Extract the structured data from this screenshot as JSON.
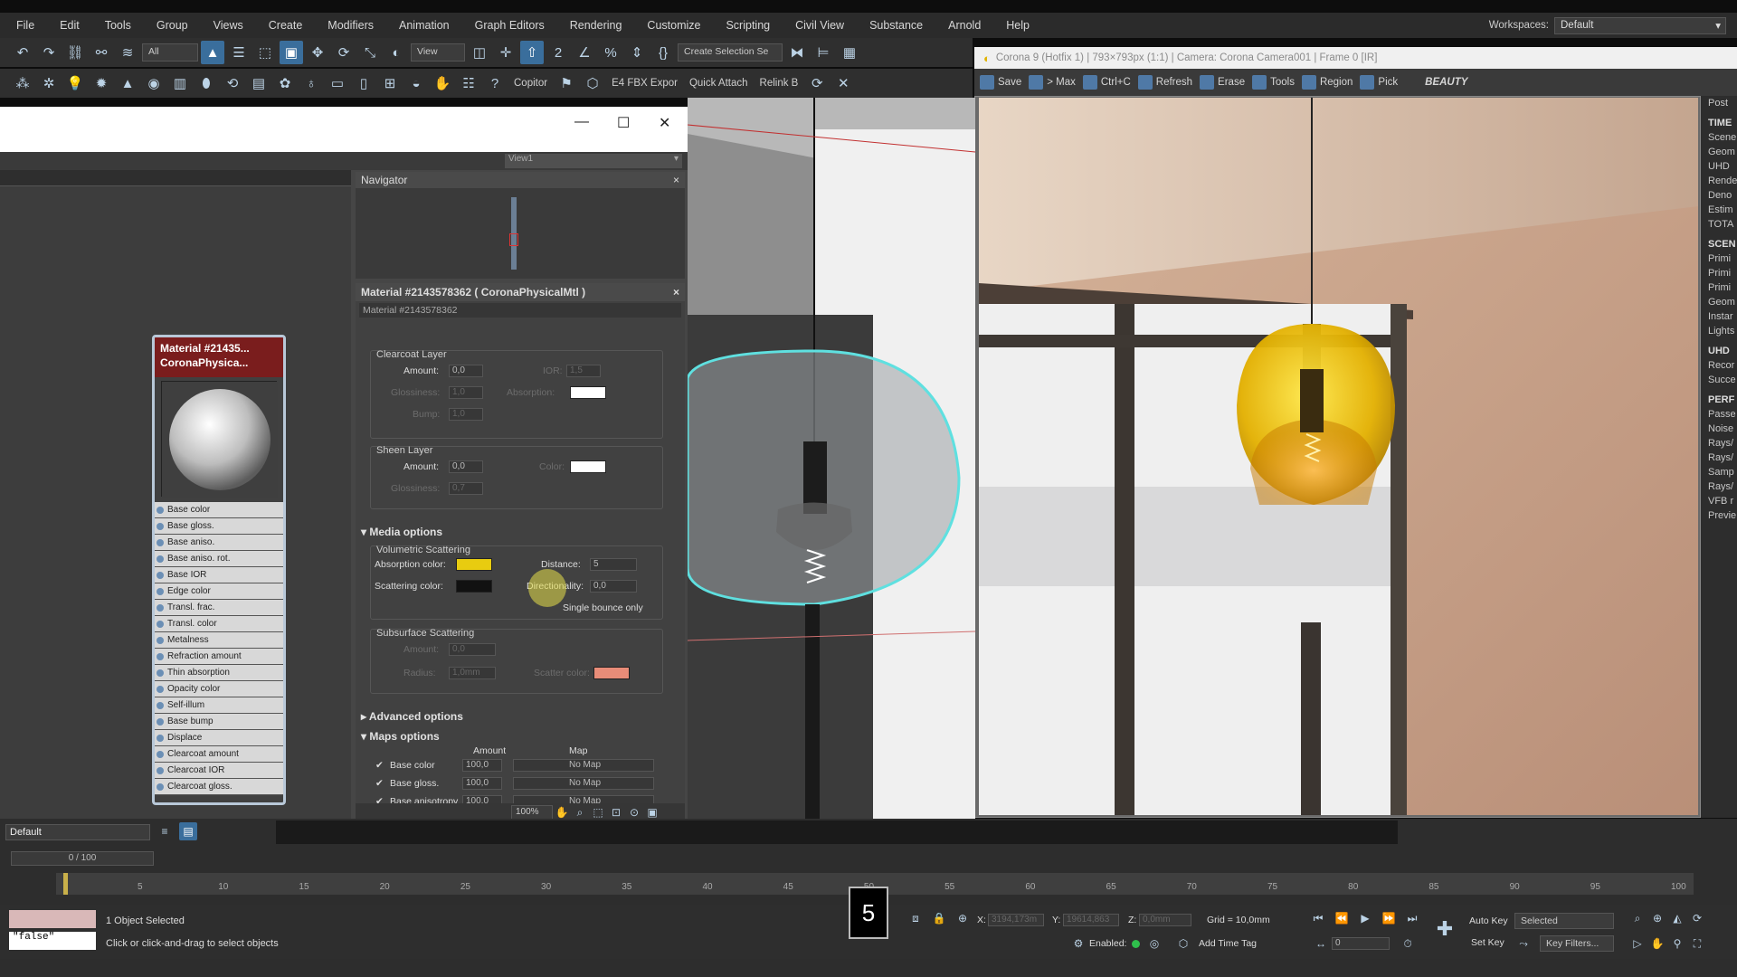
{
  "menu": [
    "File",
    "Edit",
    "Tools",
    "Group",
    "Views",
    "Create",
    "Modifiers",
    "Animation",
    "Graph Editors",
    "Rendering",
    "Customize",
    "Scripting",
    "Civil View",
    "Substance",
    "Arnold",
    "Help"
  ],
  "workspace": {
    "label": "Workspaces:",
    "value": "Default"
  },
  "toolbar1": {
    "selection_filter": "All",
    "ref_coord": "View",
    "named_selection": "Create Selection Se"
  },
  "toolbar2": {
    "copitor": "Copitor",
    "fbx": "E4 FBX Expor",
    "quick_attach": "Quick Attach",
    "relink": "Relink B"
  },
  "vfb": {
    "title": "Corona 9 (Hotfix 1) | 793×793px (1:1) | Camera: Corona Camera001 | Frame 0 [IR]",
    "buttons": [
      "Save",
      "> Max",
      "Ctrl+C",
      "Refresh",
      "Erase",
      "Tools",
      "Region",
      "Pick"
    ],
    "channel": "BEAUTY",
    "side": {
      "post": "Post",
      "time_h": "TIME",
      "time_items": [
        "Scene",
        "Geom",
        "UHD",
        "Rende",
        "Deno",
        "Estim",
        "TOTA"
      ],
      "scene_h": "SCEN",
      "scene_items": [
        "Primi",
        "Primi",
        "Primi",
        "Geom",
        "Instar",
        "Lights"
      ],
      "uhd_h": "UHD",
      "uhd_items": [
        "Recor",
        "Succe"
      ],
      "perf_h": "PERF",
      "perf_items": [
        "Passe",
        "Noise",
        "Rays/",
        "Rays/",
        "Samp",
        "Rays/",
        "VFB r",
        "Previe"
      ]
    }
  },
  "slate": {
    "view_tab": "View1",
    "navigator": "Navigator",
    "node_title_1": "Material #21435...",
    "node_title_2": "CoronaPhysica...",
    "slots": [
      "Base color",
      "Base gloss.",
      "Base aniso.",
      "Base aniso. rot.",
      "Base IOR",
      "Edge color",
      "Transl. frac.",
      "Transl. color",
      "Metalness",
      "Refraction amount",
      "Thin absorption",
      "Opacity color",
      "Self-illum",
      "Base bump",
      "Displace",
      "Clearcoat amount",
      "Clearcoat IOR",
      "Clearcoat gloss."
    ],
    "params_title": "Material #2143578362  ( CoronaPhysicalMtl )",
    "params_name": "Material #2143578362",
    "clearcoat": {
      "title": "Clearcoat Layer",
      "amount_l": "Amount:",
      "amount": "0,0",
      "ior_l": "IOR:",
      "ior": "1,5",
      "gloss_l": "Glossiness:",
      "gloss": "1,0",
      "absorption_l": "Absorption:",
      "bump_l": "Bump:",
      "bump": "1,0"
    },
    "sheen": {
      "title": "Sheen Layer",
      "amount_l": "Amount:",
      "amount": "0,0",
      "color_l": "Color:",
      "gloss_l": "Glossiness:",
      "gloss": "0,7"
    },
    "media": {
      "section": "Media options",
      "vol_title": "Volumetric Scattering",
      "abs_l": "Absorption color:",
      "dist_l": "Distance:",
      "dist": "5",
      "scat_l": "Scattering color:",
      "dir_l": "Directionality:",
      "dir": "0,0",
      "single": "Single bounce only"
    },
    "sss": {
      "title": "Subsurface Scattering",
      "amount_l": "Amount:",
      "amount": "0,0",
      "radius_l": "Radius:",
      "radius": "1,0mm",
      "color_l": "Scatter color:"
    },
    "advanced": "Advanced options",
    "maps": {
      "section": "Maps options",
      "amount_h": "Amount",
      "map_h": "Map",
      "rows": [
        {
          "name": "Base color",
          "amount": "100,0",
          "map": "No Map"
        },
        {
          "name": "Base gloss.",
          "amount": "100,0",
          "map": "No Map"
        },
        {
          "name": "Base anisotropy",
          "amount": "100,0",
          "map": "No Map"
        }
      ]
    },
    "zoom": "100%"
  },
  "timeline": {
    "layer": "Default",
    "time": "0 / 100",
    "ticks": [
      "5",
      "10",
      "15",
      "20",
      "25",
      "30",
      "35",
      "40",
      "45",
      "50",
      "55",
      "60",
      "65",
      "70",
      "75",
      "80",
      "85",
      "90",
      "95",
      "100"
    ]
  },
  "status": {
    "selected": "1 Object Selected",
    "prompt": "Click or click-and-drag to select objects",
    "listener": "\"false\"",
    "key": "5",
    "x_l": "X:",
    "x": "3194,173m",
    "y_l": "Y:",
    "y": "19614,863",
    "z_l": "Z:",
    "z": "0,0mm",
    "grid": "Grid = 10,0mm",
    "enabled": "Enabled:",
    "add_time_tag": "Add Time Tag",
    "auto_key": "Auto Key",
    "set_key": "Set Key",
    "key_mode": "Selected",
    "key_filters": "Key Filters...",
    "frame": "0"
  },
  "colors": {
    "absorption": "#e8cc10",
    "scattering": "#111111",
    "scatter_color": "#e88c78",
    "white": "#ffffff"
  }
}
